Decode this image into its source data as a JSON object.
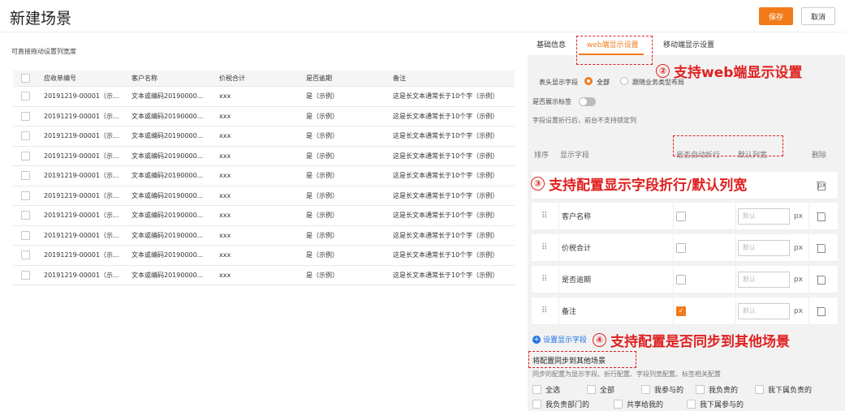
{
  "header": {
    "title": "新建场景",
    "save_label": "保存",
    "cancel_label": "取消"
  },
  "left": {
    "hint": "可直接拖动设置列宽度",
    "columns": [
      "应收单编号",
      "客户名称",
      "价税合计",
      "是否逾期",
      "备注"
    ],
    "rows": [
      [
        "20191219-00001（示...",
        "文本或编码20190000...",
        "xxx",
        "是（示例）",
        "这是长文本通常长于10个字（示例）"
      ],
      [
        "20191219-00001（示...",
        "文本或编码20190000...",
        "xxx",
        "是（示例）",
        "这是长文本通常长于10个字（示例）"
      ],
      [
        "20191219-00001（示...",
        "文本或编码20190000...",
        "xxx",
        "是（示例）",
        "这是长文本通常长于10个字（示例）"
      ],
      [
        "20191219-00001（示...",
        "文本或编码20190000...",
        "xxx",
        "是（示例）",
        "这是长文本通常长于10个字（示例）"
      ],
      [
        "20191219-00001（示...",
        "文本或编码20190000...",
        "xxx",
        "是（示例）",
        "这是长文本通常长于10个字（示例）"
      ],
      [
        "20191219-00001（示...",
        "文本或编码20190000...",
        "xxx",
        "是（示例）",
        "这是长文本通常长于10个字（示例）"
      ],
      [
        "20191219-00001（示...",
        "文本或编码20190000...",
        "xxx",
        "是（示例）",
        "这是长文本通常长于10个字（示例）"
      ],
      [
        "20191219-00001（示...",
        "文本或编码20190000...",
        "xxx",
        "是（示例）",
        "这是长文本通常长于10个字（示例）"
      ],
      [
        "20191219-00001（示...",
        "文本或编码20190000...",
        "xxx",
        "是（示例）",
        "这是长文本通常长于10个字（示例）"
      ],
      [
        "20191219-00001（示...",
        "文本或编码20190000...",
        "xxx",
        "是（示例）",
        "这是长文本通常长于10个字（示例）"
      ]
    ]
  },
  "right": {
    "tabs": [
      "基础信息",
      "web端显示设置",
      "移动端显示设置"
    ],
    "header_field_label": "表头显示字段",
    "radio_all": "全部",
    "radio_follow": "跟随业务类型布局",
    "show_tag_label": "是否展示标签",
    "wrap_note": "字段设置折行后，前台不支持锁定列",
    "grid_headers": {
      "order": "排序",
      "field": "显示字段",
      "wrap": "是否自动折行",
      "width": "默认列宽",
      "delete": "删除"
    },
    "fields": [
      {
        "name": "客户名称",
        "wrap": false,
        "placeholder": "默认",
        "unit": "px"
      },
      {
        "name": "价税合计",
        "wrap": false,
        "placeholder": "默认",
        "unit": "px"
      },
      {
        "name": "是否逾期",
        "wrap": false,
        "placeholder": "默认",
        "unit": "px"
      },
      {
        "name": "备注",
        "wrap": true,
        "placeholder": "默认",
        "unit": "px"
      }
    ],
    "first_row_unit": "px",
    "add_field": "设置显示字段",
    "sync_title": "将配置同步到其他场景",
    "sync_desc": "同步的配置为显示字段、折行配置、字段列宽配置、标签相关配置",
    "scopes": [
      "全选",
      "全部",
      "我参与的",
      "我负责的",
      "我下属负责的",
      "我负责部门的",
      "共享给我的",
      "我下属参与的"
    ]
  },
  "annotations": {
    "a2_num": "②",
    "a2_text": "支持web端显示设置",
    "a3_num": "③",
    "a3_text": "支持配置显示字段折行/默认列宽",
    "a4_num": "④",
    "a4_text": "支持配置是否同步到其他场景"
  },
  "colors": {
    "accent": "#f27a1a",
    "link": "#1a73e8",
    "annotation": "#e02020"
  }
}
